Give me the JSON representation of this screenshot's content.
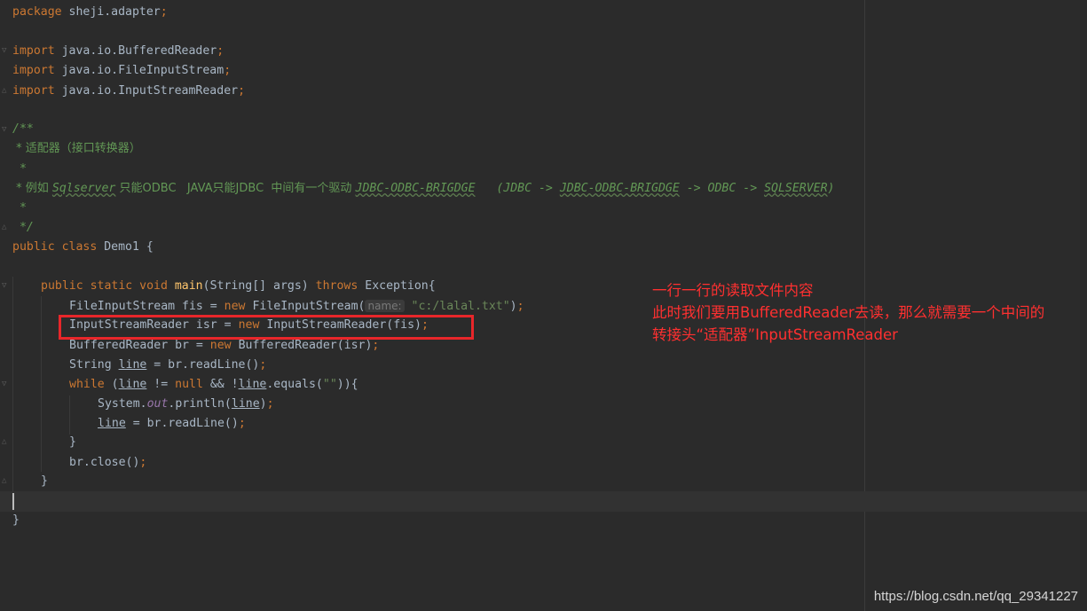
{
  "code": {
    "l1": {
      "kw": "package",
      "rest": " sheji.adapter",
      "semi": ";"
    },
    "l3": {
      "kw": "import",
      "rest": " java.io.BufferedReader",
      "semi": ";"
    },
    "l4": {
      "kw": "import",
      "rest": " java.io.FileInputStream",
      "semi": ";"
    },
    "l5": {
      "kw": "import",
      "rest": " java.io.InputStreamReader",
      "semi": ";"
    },
    "l7": "/**",
    "l8": " * 适配器（接口转换器）",
    "l9": " *",
    "l10": {
      "a": " * 例如 ",
      "b": "Sqlserver",
      "c": " 只能ODBC   JAVA只能JDBC  中间有一个驱动 ",
      "d": "JDBC-ODBC-BRIGDGE",
      "e": "   (JDBC -> ",
      "f": "JDBC-ODBC-BRIGDGE",
      "g": " -> ODBC -> ",
      "h": "SQLSERVER",
      "i": ")"
    },
    "l11": " *",
    "l12": " */",
    "l13": {
      "kw1": "public",
      "kw2": " class",
      "rest": " Demo1 {"
    },
    "l15": {
      "kw1": "public",
      "kw2": " static",
      "kw3": " void",
      "fn": " main",
      "params": "(String[] args) ",
      "kw4": "throws",
      "rest": " Exception{"
    },
    "l16": {
      "a": "FileInputStream fis = ",
      "kw": "new",
      "b": " FileInputStream(",
      "hint": "name:",
      "str": " \"c:/lalal.txt\"",
      "c": ")",
      "semi": ";"
    },
    "l17": {
      "a": "InputStreamReader isr = ",
      "kw": "new",
      "b": " InputStreamReader(fis)",
      "semi": ";"
    },
    "l18": {
      "a": "BufferedReader br = ",
      "kw": "new",
      "b": " BufferedReader(isr)",
      "semi": ";"
    },
    "l19": {
      "a": "String ",
      "v": "line",
      "b": " = br.readLine()",
      "semi": ";"
    },
    "l20": {
      "kw": "while",
      "a": " (",
      "v1": "line",
      "b": " != ",
      "kw2": "null",
      "c": " && !",
      "v2": "line",
      "d": ".equals(",
      "str": "\"\"",
      "e": ")){"
    },
    "l21": {
      "a": "System.",
      "field": "out",
      "b": ".println(",
      "v": "line",
      "c": ")",
      "semi": ";"
    },
    "l22": {
      "v": "line",
      "a": " = br.readLine()",
      "semi": ";"
    },
    "l23": "}",
    "l24": {
      "a": "br.close()",
      "semi": ";"
    },
    "l25": "}",
    "l27": "}"
  },
  "annotation": {
    "line1": "一行一行的读取文件内容",
    "line2": "此时我们要用BufferedReader去读，那么就需要一个中间的",
    "line3": "转接头“适配器”InputStreamReader"
  },
  "watermark": "https://blog.csdn.net/qq_29341227",
  "colors": {
    "background": "#2b2b2b",
    "keyword": "#cc7832",
    "string": "#6a8759",
    "comment": "#629755",
    "function": "#ffc66d",
    "highlight_box": "#e8262a",
    "annotation": "#ff3030"
  }
}
